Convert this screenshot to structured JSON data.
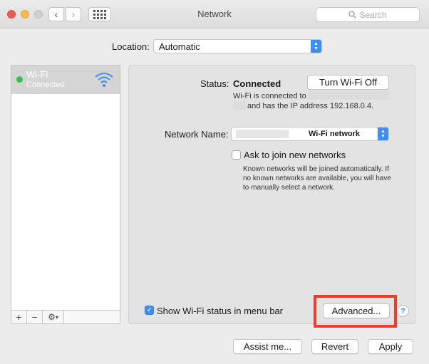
{
  "window": {
    "title": "Network",
    "search_placeholder": "Search"
  },
  "location": {
    "label": "Location:",
    "value": "Automatic"
  },
  "sidebar": {
    "services": [
      {
        "name": "Wi-Fi",
        "status": "Connected",
        "status_color": "#36c246"
      }
    ],
    "tools": [
      "+",
      "−",
      "⚙"
    ]
  },
  "status": {
    "label": "Status:",
    "value": "Connected",
    "toggle_button": "Turn Wi-Fi Off",
    "info_line1": "Wi-Fi is connected to",
    "info_line2": "and has the IP address 192.168.0.4."
  },
  "network_name": {
    "label": "Network Name:",
    "value": "Wi-Fi network"
  },
  "ask_join": {
    "label": "Ask to join new networks",
    "checked": false,
    "help": "Known networks will be joined automatically. If no known networks are available, you will have to manually select a network."
  },
  "show_status": {
    "label": "Show Wi-Fi status in menu bar",
    "checked": true
  },
  "buttons": {
    "advanced": "Advanced...",
    "help": "?",
    "assist": "Assist me...",
    "revert": "Revert",
    "apply": "Apply"
  },
  "colors": {
    "accent": "#3d8ef0",
    "highlight": "#ee3d2c"
  }
}
